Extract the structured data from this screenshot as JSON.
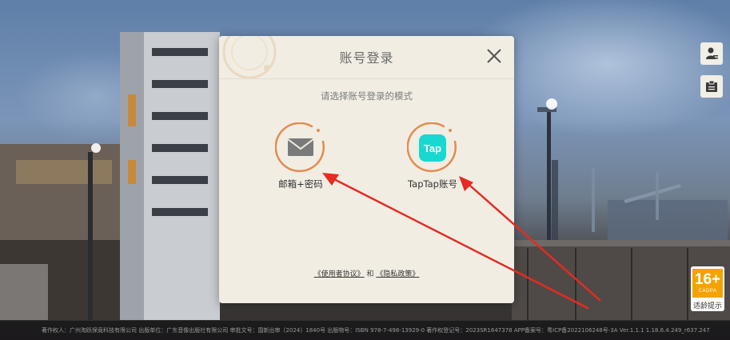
{
  "dialog": {
    "title": "账号登录",
    "subtitle": "请选择账号登录的模式",
    "options": [
      {
        "label": "邮箱+密码",
        "icon": "mail-icon"
      },
      {
        "label": "TapTap账号",
        "icon": "taptap-icon",
        "logo_text": "Tap"
      }
    ],
    "agreements": {
      "user_agreement": "《使用者协议》",
      "connector": "和",
      "privacy_policy": "《隐私政策》"
    }
  },
  "age_rating": {
    "age": "16+",
    "org": "CADPA",
    "label": "适龄提示"
  },
  "footer": {
    "text": "著作权人：广州淘跃保竟科技有限公司 出版单位：广东音像出版社有限公司 审批文号：国新出审〔2024〕1840号 出版物号：ISBN 978-7-498-13929-0 著作权登记号：2023SR1647378 APP备案号：粤ICP备2022106248号-3A Ver.1.1.1 1.18.6.4.249_r637.247"
  },
  "colors": {
    "dialog_bg": "#f1ede3",
    "accent_orange": "#e48b4e",
    "taptap_cyan": "#19d8d0",
    "arrow_red": "#e52b22",
    "age_orange": "#f4a300"
  }
}
